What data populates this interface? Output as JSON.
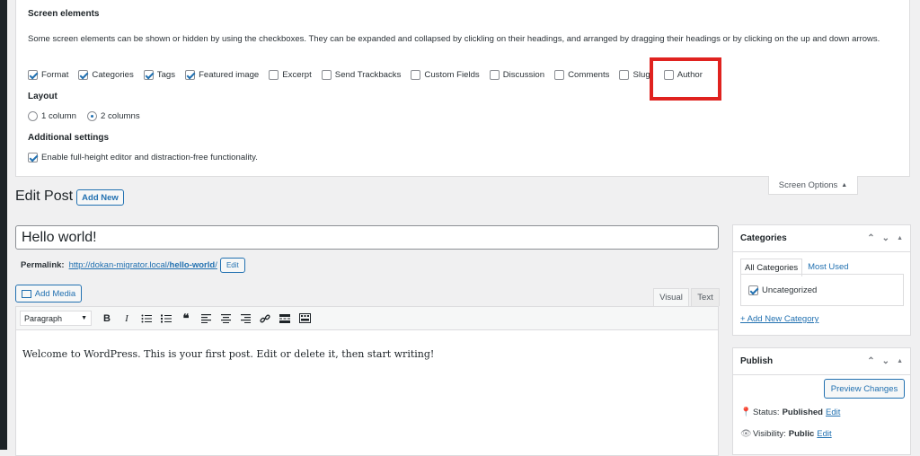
{
  "screen_options": {
    "heading": "Screen elements",
    "description": "Some screen elements can be shown or hidden by using the checkboxes. They can be expanded and collapsed by clickling on their headings, and arranged by dragging their headings or by clicking on the up and down arrows.",
    "elements": [
      {
        "label": "Format",
        "checked": true
      },
      {
        "label": "Categories",
        "checked": true
      },
      {
        "label": "Tags",
        "checked": true
      },
      {
        "label": "Featured image",
        "checked": true
      },
      {
        "label": "Excerpt",
        "checked": false
      },
      {
        "label": "Send Trackbacks",
        "checked": false
      },
      {
        "label": "Custom Fields",
        "checked": false
      },
      {
        "label": "Discussion",
        "checked": false
      },
      {
        "label": "Comments",
        "checked": false
      },
      {
        "label": "Slug",
        "checked": false
      },
      {
        "label": "Author",
        "checked": false
      }
    ],
    "layout_heading": "Layout",
    "layout_options": [
      {
        "label": "1 column",
        "selected": false
      },
      {
        "label": "2 columns",
        "selected": true
      }
    ],
    "additional_heading": "Additional settings",
    "additional_option": {
      "label": "Enable full-height editor and distraction-free functionality.",
      "checked": true
    },
    "tab_label": "Screen Options",
    "highlight_color": "#e0221f"
  },
  "page": {
    "title": "Edit Post",
    "add_new": "Add New"
  },
  "post": {
    "title": "Hello world!",
    "permalink_label": "Permalink:",
    "permalink_base": "http://dokan-migrator.local/",
    "permalink_slug": "hello-world",
    "permalink_trail": "/",
    "permalink_edit": "Edit"
  },
  "editor": {
    "add_media": "Add Media",
    "tab_visual": "Visual",
    "tab_text": "Text",
    "format_select": "Paragraph",
    "content": "Welcome to WordPress. This is your first post. Edit or delete it, then start writing!",
    "toolbar_icons": [
      "bold-icon",
      "italic-icon",
      "bullet-list-icon",
      "numbered-list-icon",
      "blockquote-icon",
      "align-left-icon",
      "align-center-icon",
      "align-right-icon",
      "link-icon",
      "read-more-icon",
      "toolbar-toggle-icon"
    ]
  },
  "categories_box": {
    "title": "Categories",
    "tab_all": "All Categories",
    "tab_most": "Most Used",
    "items": [
      {
        "label": "Uncategorized",
        "checked": true
      }
    ],
    "add_link": "+ Add New Category"
  },
  "publish_box": {
    "title": "Publish",
    "preview": "Preview Changes",
    "status_label": "Status:",
    "status_value": "Published",
    "visibility_label": "Visibility:",
    "visibility_value": "Public",
    "edit_link": "Edit"
  },
  "colors": {
    "accent": "#2271b1",
    "admin_bar": "#1d2327",
    "background": "#f0f0f1"
  }
}
